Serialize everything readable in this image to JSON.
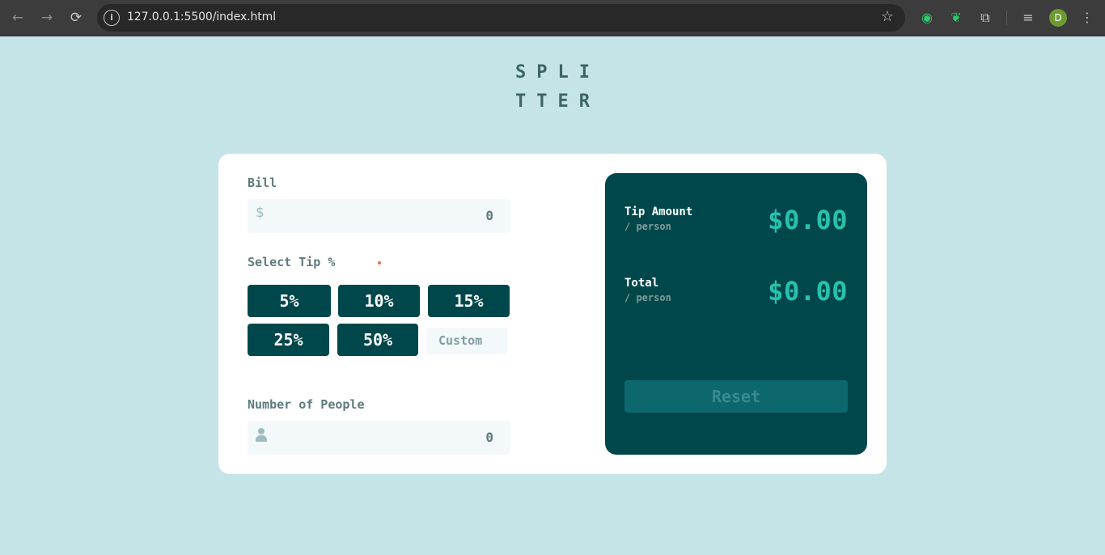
{
  "browser": {
    "url": "127.0.0.1:5500/index.html",
    "profile_initial": "D"
  },
  "app": {
    "logo_line1": "SPLI",
    "logo_line2": "TTER",
    "bill": {
      "label": "Bill",
      "currency": "$",
      "value": "0"
    },
    "tip": {
      "label": "Select Tip %",
      "options": [
        "5%",
        "10%",
        "15%",
        "25%",
        "50%"
      ],
      "custom_placeholder": "Custom"
    },
    "people": {
      "label": "Number of People",
      "value": "0"
    },
    "results": {
      "tip_label": "Tip Amount",
      "tip_sub": "/ person",
      "tip_value": "$0.00",
      "total_label": "Total",
      "total_sub": "/ person",
      "total_value": "$0.00",
      "reset_label": "Reset"
    },
    "colors": {
      "background": "#c5e4e7",
      "dark_cyan": "#00474b",
      "accent": "#26c2ae",
      "error": "#e17052"
    }
  }
}
